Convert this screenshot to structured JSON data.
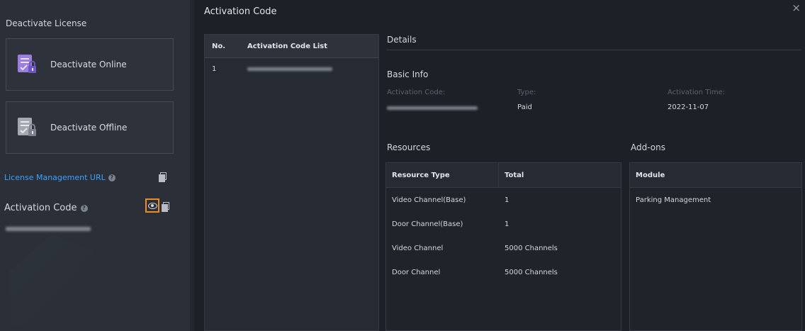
{
  "left": {
    "title": "Deactivate License",
    "deactivate_online_label": "Deactivate Online",
    "deactivate_offline_label": "Deactivate Offline",
    "license_url_label": "License Management URL",
    "activation_code_label": "Activation Code",
    "help_glyph": "?"
  },
  "modal": {
    "title": "Activation Code",
    "close_glyph": "×",
    "list": {
      "headers": [
        "No.",
        "Activation Code List"
      ],
      "rows": [
        {
          "no": "1"
        }
      ]
    },
    "details": {
      "title": "Details",
      "basic_info_title": "Basic Info",
      "labels": {
        "activation_code": "Activation Code:",
        "type": "Type:",
        "activation_time": "Activation Time:"
      },
      "values": {
        "type": "Paid",
        "activation_time": "2022-11-07"
      },
      "resources_title": "Resources",
      "addons_title": "Add-ons",
      "resources_headers": [
        "Resource Type",
        "Total"
      ],
      "resources_rows": [
        {
          "type": "Video Channel(Base)",
          "total": "1"
        },
        {
          "type": "Door Channel(Base)",
          "total": "1"
        },
        {
          "type": "Video Channel",
          "total": "5000 Channels"
        },
        {
          "type": "Door Channel",
          "total": "5000 Channels"
        }
      ],
      "addons_header": "Module",
      "addons_rows": [
        "Parking Management"
      ]
    }
  },
  "colors": {
    "link": "#3ea0ff",
    "highlight": "#f08a24",
    "accent_purple": "#8b6ad6"
  }
}
